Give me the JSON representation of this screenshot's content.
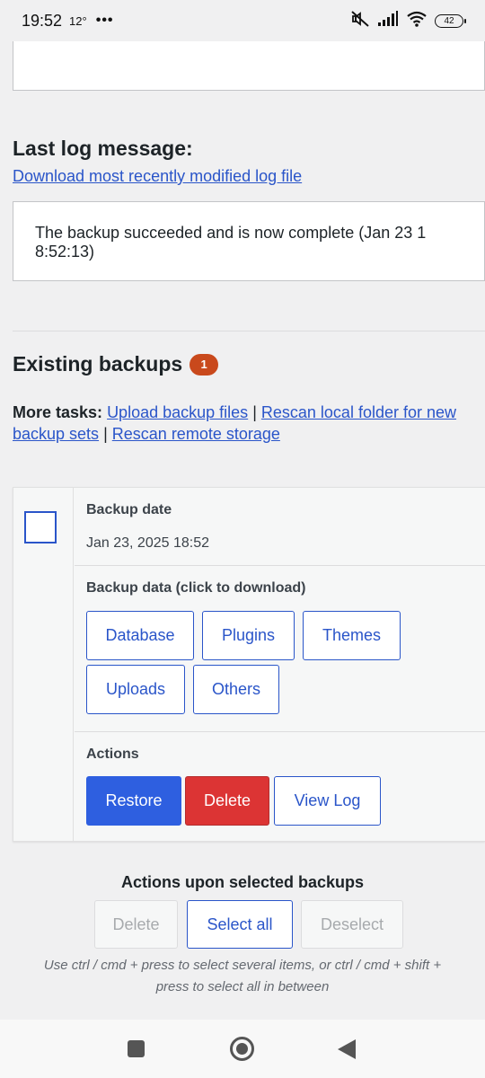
{
  "status_bar": {
    "time": "19:52",
    "temperature": "12°",
    "dots": "•••",
    "battery": "42"
  },
  "log": {
    "heading": "Last log message:",
    "download_link": "Download most recently modified log file",
    "message": "The backup succeeded and is now complete (Jan 23 1 8:52:13)"
  },
  "existing": {
    "heading": "Existing backups",
    "count": "1",
    "more_tasks_label": "More tasks:",
    "links": {
      "upload": "Upload backup files",
      "rescan_local": "Rescan local folder for new backup sets",
      "rescan_remote": "Rescan remote storage"
    },
    "separator": "|"
  },
  "backup": {
    "date_label": "Backup date",
    "date_value": "Jan 23, 2025 18:52",
    "data_label": "Backup data (click to download)",
    "data_buttons": [
      "Database",
      "Plugins",
      "Themes",
      "Uploads",
      "Others"
    ],
    "actions_label": "Actions",
    "actions": {
      "restore": "Restore",
      "delete": "Delete",
      "view_log": "View Log"
    }
  },
  "bulk": {
    "title": "Actions upon selected backups",
    "delete": "Delete",
    "select_all": "Select all",
    "deselect": "Deselect",
    "hint": "Use ctrl / cmd + press to select several items, or ctrl / cmd + shift + press to select all in between"
  },
  "colors": {
    "link": "#2a55c9",
    "primary": "#2e5fe0",
    "danger": "#dc3434",
    "badge": "#c9491c"
  }
}
